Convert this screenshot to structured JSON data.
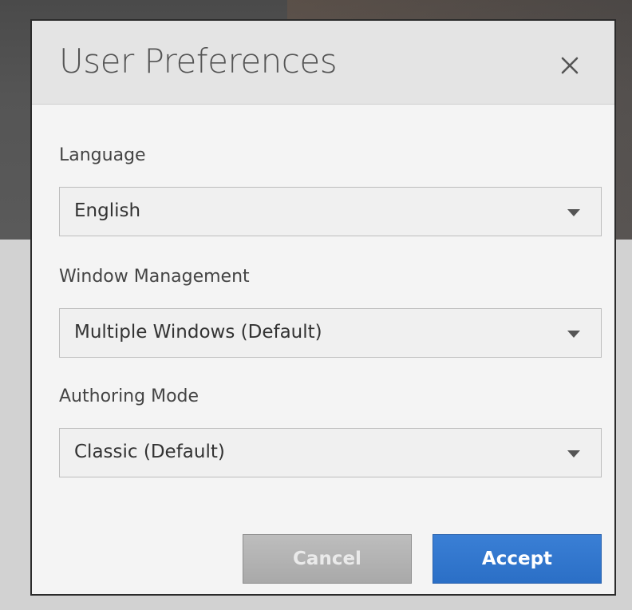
{
  "dialog": {
    "title": "User Preferences",
    "close_icon": "close-icon"
  },
  "fields": {
    "language": {
      "label": "Language",
      "value": "English"
    },
    "window_management": {
      "label": "Window Management",
      "value": "Multiple Windows (Default)"
    },
    "authoring_mode": {
      "label": "Authoring Mode",
      "value": "Classic (Default)"
    }
  },
  "buttons": {
    "cancel_label": "Cancel",
    "accept_label": "Accept"
  },
  "colors": {
    "accent": "#2b6fc6",
    "cancel": "#a9a9a9"
  }
}
